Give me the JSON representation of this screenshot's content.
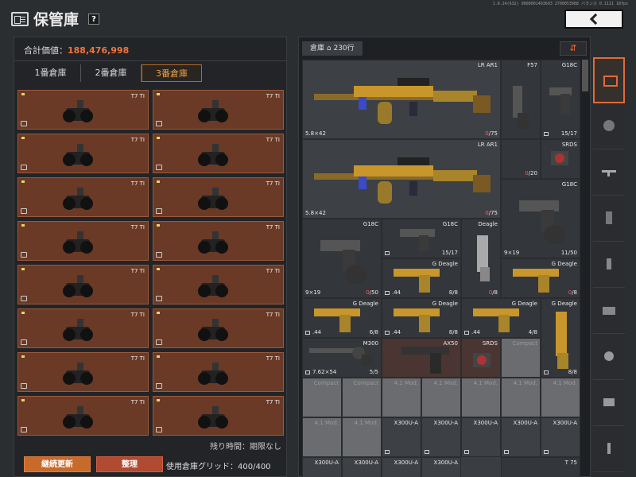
{
  "header": {
    "title": "保管庫",
    "help": "?",
    "topinfo": "1.0.24(632) 0000001403603 2700053988 バランス 0.1111 18fps"
  },
  "left": {
    "total_label": "合計価値：",
    "total_value": "188,476,998",
    "tabs": [
      {
        "label": "1番倉庫",
        "active": false
      },
      {
        "label": "2番倉庫",
        "active": false
      },
      {
        "label": "3番倉庫",
        "active": true
      }
    ],
    "items": [
      {
        "name": "T7 TI"
      },
      {
        "name": "T7 TI"
      },
      {
        "name": "T7 TI"
      },
      {
        "name": "T7 TI"
      },
      {
        "name": "T7 TI"
      },
      {
        "name": "T7 TI"
      },
      {
        "name": "T7 TI"
      },
      {
        "name": "T7 TI"
      },
      {
        "name": "T7 TI"
      },
      {
        "name": "T7 TI"
      },
      {
        "name": "T7 TI"
      },
      {
        "name": "T7 TI"
      },
      {
        "name": "T7 TI"
      },
      {
        "name": "T7 TI"
      },
      {
        "name": "T7 TI"
      },
      {
        "name": "T7 TI"
      }
    ],
    "remain": "残り時間：期限なし",
    "btn_renew": "継続更新",
    "btn_sort": "整理",
    "grid_usage": "使用倉庫グリッド：400/400"
  },
  "right": {
    "storage_tab": "倉庫",
    "storage_rows": "230行",
    "items": {
      "lr1": {
        "name": "LR AR1",
        "cal": "5.8×42",
        "cnt_a": "0",
        "cnt_b": "/75"
      },
      "f57": {
        "name": "F57"
      },
      "g18c_1": {
        "name": "G18C",
        "cnt": "15/17"
      },
      "srds_1": {
        "name": "SRDS",
        "cnt_a": "0",
        "cnt_b": "/20"
      },
      "lr2": {
        "name": "LR AR1",
        "cal": "5.8×42",
        "cnt_a": "0",
        "cnt_b": "/75"
      },
      "g18c_2": {
        "name": "G18C",
        "cal": "9×19",
        "cnt": "11/50"
      },
      "g18c_3": {
        "name": "G18C",
        "cal": "9×19",
        "cnt_a": "0",
        "cnt_b": "/50"
      },
      "g18c_4": {
        "name": "G18C",
        "cal": "9×19",
        "cnt": "15/17"
      },
      "deagle_1": {
        "name": "Deagle",
        "cnt_a": "0",
        "cnt_b": "/8"
      },
      "gdeagle_1": {
        "name": "G Deagle",
        "cal": ".44",
        "cnt": "8/8"
      },
      "gdeagle_2": {
        "name": "G Deagle",
        "cnt_a": "0",
        "cnt_b": "/8"
      },
      "gdeagle_3": {
        "name": "G Deagle",
        "cal": ".44",
        "cnt": "6/8"
      },
      "gdeagle_4": {
        "name": "G Deagle",
        "cal": ".44",
        "cnt": "8/8"
      },
      "gdeagle_5": {
        "name": "G Deagle",
        "cal": ".44",
        "cnt": "4/8"
      },
      "gdeagle_6": {
        "name": "G Deagle",
        "cnt": "8/8"
      },
      "m300": {
        "name": "M300",
        "cal": "7.62×54",
        "cnt": "5/5"
      },
      "ax50": {
        "name": "AX50"
      },
      "srds_2": {
        "name": "SRDS"
      },
      "compact_1": {
        "name": "Compact"
      },
      "compact_2": {
        "name": "Compact"
      },
      "compact_3": {
        "name": "Compact"
      },
      "mod_1": {
        "name": "4.1 Mod."
      },
      "mod_2": {
        "name": "4.1 Mod."
      },
      "mod_3": {
        "name": "4.1 Mod."
      },
      "mod_4": {
        "name": "4.1 Mod."
      },
      "mod_5": {
        "name": "4.1 Mod."
      },
      "mod_6": {
        "name": "4.1 Mod."
      },
      "mod_7": {
        "name": "4.1 Mod."
      },
      "x300_1": {
        "name": "X300U-A"
      },
      "x300_2": {
        "name": "X300U-A"
      },
      "x300_3": {
        "name": "X300U-A"
      },
      "x300_4": {
        "name": "X300U-A"
      },
      "x300_5": {
        "name": "X300U-A"
      },
      "x300_6": {
        "name": "X300U-A"
      },
      "x300_7": {
        "name": "X300U-A"
      },
      "x300_8": {
        "name": "X300U-A"
      },
      "x300_9": {
        "name": "X300U-A"
      },
      "t75": {
        "name": "T 75"
      }
    }
  },
  "colors": {
    "accent": "#f0743f",
    "active_tab": "#f0a046",
    "nv_bg": "#6a3a26"
  }
}
